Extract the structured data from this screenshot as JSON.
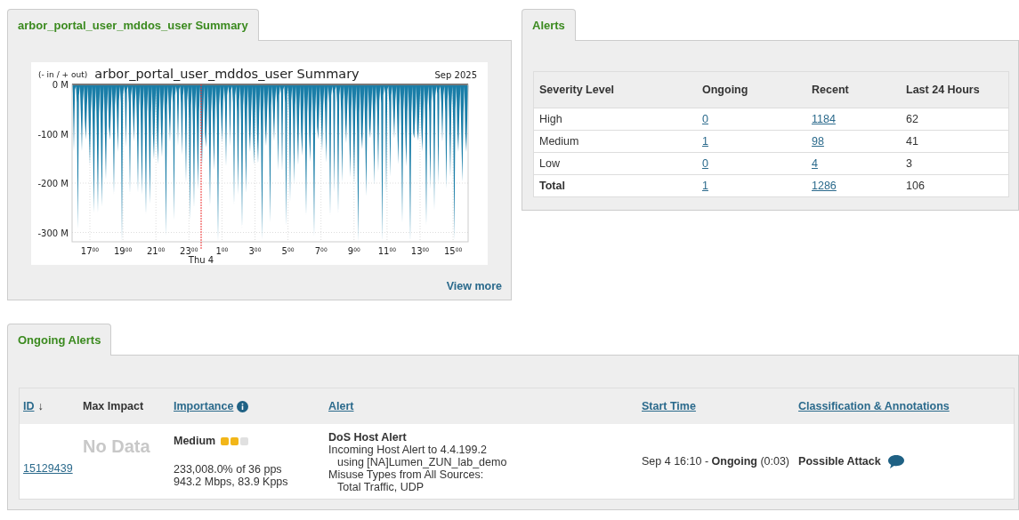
{
  "summary_panel": {
    "tab": "arbor_portal_user_mddos_user Summary",
    "graph": {
      "legend": "(- in / + out)",
      "title": "arbor_portal_user_mddos_user Summary",
      "date": "Sep 2025",
      "y_labels": [
        "0 M",
        "-100 M",
        "-200 M",
        "-300 M"
      ],
      "x_labels": [
        "17$^{00}$",
        "19$^{00}$",
        "21$^{00}$",
        "23$^{00}$",
        "1$^{00}$",
        "3$^{00}$",
        "5$^{00}$",
        "7$^{00}$",
        "9$^{00}$",
        "11$^{00}$",
        "13$^{00}$",
        "15$^{00}$"
      ],
      "day_label": "Thu 4"
    },
    "view_more": "View more"
  },
  "alerts_panel": {
    "tab": "Alerts",
    "columns": [
      "Severity Level",
      "Ongoing",
      "Recent",
      "Last 24 Hours"
    ],
    "rows": [
      {
        "kind": "level",
        "cells": [
          "High",
          "0",
          "1184",
          "62"
        ]
      },
      {
        "kind": "level",
        "cells": [
          "Medium",
          "1",
          "98",
          "41"
        ]
      },
      {
        "kind": "level",
        "cells": [
          "Low",
          "0",
          "4",
          "3"
        ]
      },
      {
        "kind": "total",
        "cells": [
          "Total",
          "1",
          "1286",
          "106"
        ]
      }
    ]
  },
  "ongoing_panel": {
    "tab": "Ongoing Alerts",
    "columns": [
      {
        "label": "ID",
        "link": true,
        "sort": "↓"
      },
      {
        "label": "Max Impact",
        "link": false
      },
      {
        "label": "Importance",
        "link": true,
        "info": true
      },
      {
        "label": "Alert",
        "link": true
      },
      {
        "label": "Start Time",
        "link": true
      },
      {
        "label": "Classification & Annotations",
        "link": true
      }
    ],
    "rows": [
      {
        "id": "15129439",
        "max_impact": "No Data",
        "importance": {
          "label": "Medium",
          "stars": 2,
          "lines": [
            "233,008.0% of 36 pps",
            "943.2 Mbps, 83.9 Kpps"
          ]
        },
        "alert": {
          "title": "DoS Host Alert",
          "lines": [
            {
              "text": "Incoming Host Alert to 4.4.199.2",
              "indent": false
            },
            {
              "text": "using [NA]Lumen_ZUN_lab_demo",
              "indent": true
            },
            {
              "text": "Misuse Types from All Sources:",
              "indent": false
            },
            {
              "text": "Total Traffic, UDP",
              "indent": true
            }
          ]
        },
        "start_time": "Sep 4 16:10 - **Ongoing** (0:03)",
        "classification": "Possible Attack",
        "annotation": true
      }
    ]
  }
}
